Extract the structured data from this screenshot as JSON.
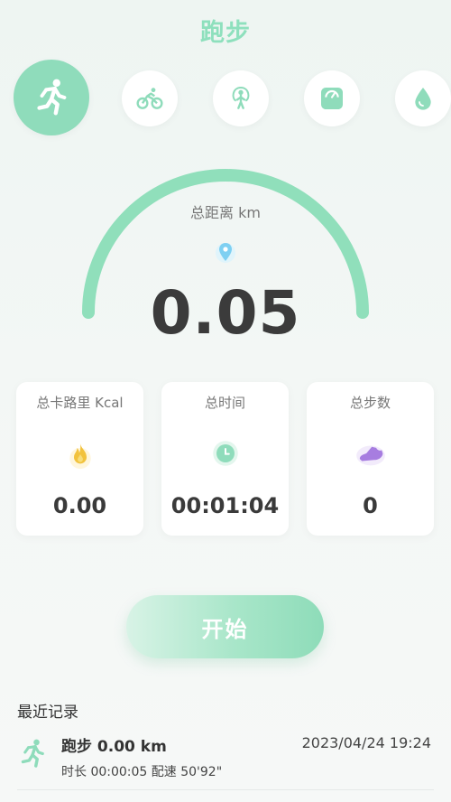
{
  "page": {
    "title": "跑步"
  },
  "categories": [
    {
      "icon": "running-icon",
      "active": true
    },
    {
      "icon": "cycling-icon",
      "active": false
    },
    {
      "icon": "jump-rope-icon",
      "active": false
    },
    {
      "icon": "scale-icon",
      "active": false
    },
    {
      "icon": "water-drop-icon",
      "active": false
    }
  ],
  "gauge": {
    "label": "总距离 km",
    "value": "0.05",
    "icon": "location-pin-icon"
  },
  "stats": [
    {
      "label": "总卡路里 Kcal",
      "value": "0.00",
      "icon": "flame-icon"
    },
    {
      "label": "总时间",
      "value": "00:01:04",
      "icon": "clock-icon"
    },
    {
      "label": "总步数",
      "value": "0",
      "icon": "shoe-icon"
    }
  ],
  "actions": {
    "start_label": "开始"
  },
  "recent": {
    "title": "最近记录",
    "records": [
      {
        "title": "跑步 0.00 km",
        "date": "2023/04/24 19:24",
        "detail": "时长 00:00:05 配速 50'92\""
      }
    ]
  },
  "colors": {
    "accent": "#8fdcbb",
    "flame": "#f2c23c",
    "shoe": "#a77de0",
    "pin": "#7fd0f2"
  }
}
